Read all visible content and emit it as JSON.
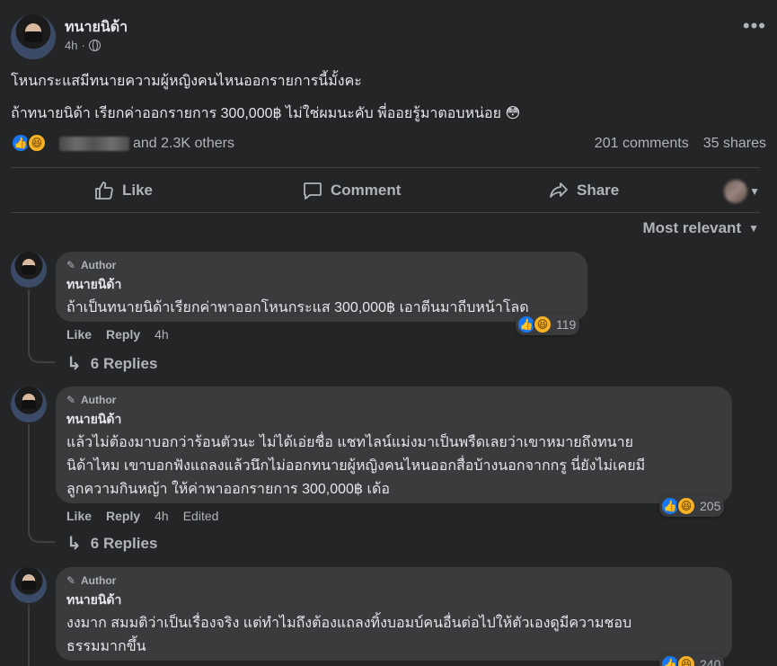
{
  "post": {
    "author": "ทนายนิด้า",
    "time": "4h",
    "line1": "โหนกระแสมีทนายความผู้หญิงคนไหนออกรายการนี้มั้งคะ",
    "line2": "ถ้าทนายนิด้า เรียกค่าออกรายการ 300,000฿ ไม่ใช่ผมนะคับ พี่ออยรู้มาตอบหน่อย 😳",
    "others": "and 2.3K others",
    "comments_count": "201 comments",
    "shares_count": "35 shares"
  },
  "actions": {
    "like": "Like",
    "comment": "Comment",
    "share": "Share"
  },
  "sort_label": "Most relevant",
  "comments": [
    {
      "tag": "Author",
      "name": "ทนายนิด้า",
      "body": "ถ้าเป็นทนายนิด้าเรียกค่าพาออกโหนกระแส 300,000฿ เอาตีนมาถีบหน้าโลด",
      "reactions": "119",
      "like": "Like",
      "reply": "Reply",
      "time": "4h",
      "replies": "6 Replies"
    },
    {
      "tag": "Author",
      "name": "ทนายนิด้า",
      "body1": "แล้วไม่ต้องมาบอกว่าร้อนตัวนะ ไม่ได้เอ่ยชื่อ แชทไลน์แม่งมาเป็นพรืดเลยว่าเขาหมายถึงทนาย",
      "body2": "นิด้าไหม เขาบอกฟังแถลงแล้วนึกไม่ออกทนายผู้หญิงคนไหนออกสื่อบ้างนอกจากกรู นี่ยังไม่เคยมี",
      "body3": "ลูกความกินหญ้า ให้ค่าพาออกรายการ 300,000฿ เด้อ",
      "reactions": "205",
      "like": "Like",
      "reply": "Reply",
      "time": "4h",
      "edited": "Edited",
      "replies": "6 Replies"
    },
    {
      "tag": "Author",
      "name": "ทนายนิด้า",
      "body1": "งงมาก สมมติว่าเป็นเรื่องจริง แต่ทำไมถึงต้องแถลงทิ้งบอมบ์คนอื่นต่อไปให้ตัวเองดูมีความชอบ",
      "body2": "ธรรมมากขึ้น",
      "reactions": "240"
    }
  ],
  "colors": {
    "background": "#242526",
    "bubble": "#3a3b3c",
    "text": "#e4e6eb",
    "secondary": "#b0b3b8",
    "like_blue": "#1877f2",
    "haha_yellow": "#f7b125"
  }
}
